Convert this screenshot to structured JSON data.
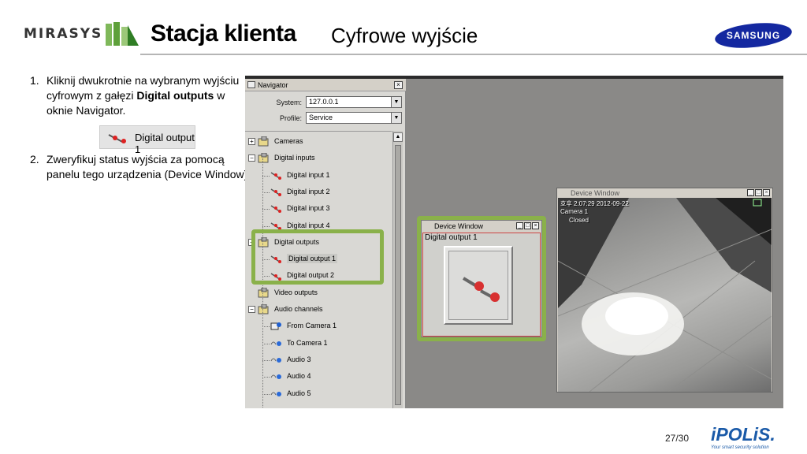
{
  "header": {
    "brand_left": "MIRASYS",
    "title": "Stacja klienta",
    "subtitle": "Cyfrowe wyjście",
    "brand_right": "SAMSUNG"
  },
  "instructions": {
    "step1_num": "1.",
    "step1_text_a": "Kliknij dwukrotnie na wybranym wyjściu cyfrowym z gałęzi ",
    "step1_bold": "Digital outputs",
    "step1_text_b": " w oknie Navigator.",
    "chip_label": "Digital output 1",
    "step2_num": "2.",
    "step2_text": "Zweryfikuj status wyjścia za pomocą panelu tego urządzenia (Device Window)."
  },
  "navigator": {
    "title": "Navigator",
    "close": "×",
    "system_label": "System:",
    "system_value": "127.0.0.1",
    "profile_label": "Profile:",
    "profile_value": "Service",
    "tree": [
      {
        "label": "Cameras",
        "level": 0,
        "expander": "+",
        "icon": "folder-camera-icon"
      },
      {
        "label": "Digital inputs",
        "level": 0,
        "expander": "−",
        "icon": "folder-camera-icon"
      },
      {
        "label": "Digital input 1",
        "level": 1,
        "icon": "digital-io-icon"
      },
      {
        "label": "Digital input 2",
        "level": 1,
        "icon": "digital-io-icon"
      },
      {
        "label": "Digital input 3",
        "level": 1,
        "icon": "digital-io-icon"
      },
      {
        "label": "Digital input 4",
        "level": 1,
        "icon": "digital-io-icon"
      },
      {
        "label": "Digital outputs",
        "level": 0,
        "expander": "−",
        "icon": "folder-camera-icon"
      },
      {
        "label": "Digital output 1",
        "level": 1,
        "icon": "digital-io-icon",
        "selected": true
      },
      {
        "label": "Digital output 2",
        "level": 1,
        "icon": "digital-io-icon"
      },
      {
        "label": "Video outputs",
        "level": 0,
        "icon": "folder-camera-icon"
      },
      {
        "label": "Audio channels",
        "level": 0,
        "expander": "−",
        "icon": "folder-camera-icon"
      },
      {
        "label": "From Camera 1",
        "level": 1,
        "icon": "camera-audio-icon"
      },
      {
        "label": "To Camera 1",
        "level": 1,
        "icon": "audio-out-icon"
      },
      {
        "label": "Audio 3",
        "level": 1,
        "icon": "audio-out-icon"
      },
      {
        "label": "Audio 4",
        "level": 1,
        "icon": "audio-out-icon"
      },
      {
        "label": "Audio 5",
        "level": 1,
        "icon": "audio-out-icon"
      }
    ]
  },
  "device_window_small": {
    "title": "Device Window",
    "label": "Digital output 1"
  },
  "device_window_camera": {
    "title": "Device Window",
    "osd_line1": "호후 2:07:29 2012-09-22",
    "osd_line2": "Camera 1",
    "osd_line3": "Closed"
  },
  "footer": {
    "page": "27/30",
    "ipolis": "iPOLiS.",
    "ipolis_tagline": "Your smart security solution"
  },
  "colors": {
    "highlight_green": "#8ab14a",
    "samsung_blue": "#1428a0",
    "ipolis_blue": "#1a5aa8"
  }
}
